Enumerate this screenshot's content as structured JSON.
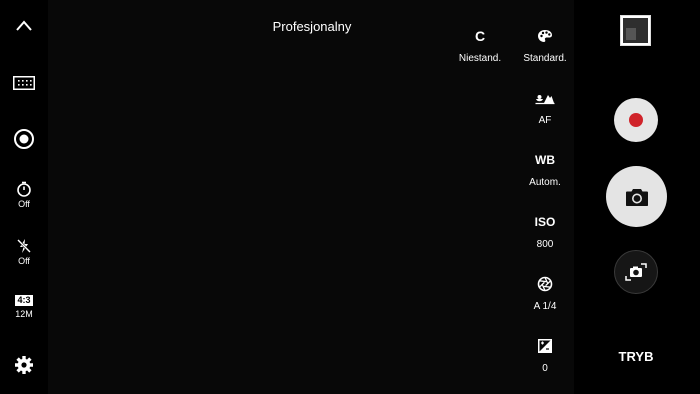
{
  "header": {
    "mode_title": "Profesjonalny"
  },
  "left_bar": {
    "collapse_icon": "chevron-up-icon",
    "grid_icon": "grid-icon",
    "focus_icon": "focus-target-icon",
    "timer": {
      "icon": "timer-icon",
      "value": "Off"
    },
    "flash": {
      "icon": "flash-off-icon",
      "value": "Off"
    },
    "ratio": {
      "badge": "4:3",
      "resolution": "12M"
    },
    "settings_icon": "gear-icon"
  },
  "pro_settings": {
    "custom": {
      "top": "C",
      "value": "Niestand."
    },
    "tone": {
      "icon": "palette-icon",
      "value": "Standard."
    },
    "focus": {
      "icon": "focus-mountain-icon",
      "value": "AF"
    },
    "wb": {
      "top": "WB",
      "value": "Autom."
    },
    "iso": {
      "top": "ISO",
      "value": "800"
    },
    "shutter": {
      "icon": "aperture-icon",
      "value": "A 1/4"
    },
    "exposure": {
      "icon": "exposure-icon",
      "value": "0"
    }
  },
  "right_bar": {
    "gallery_icon": "gallery-thumbnail",
    "record_icon": "record-icon",
    "record_color": "#d0232a",
    "shutter_icon": "camera-icon",
    "switch_icon": "switch-camera-icon",
    "mode_label": "TRYB"
  }
}
